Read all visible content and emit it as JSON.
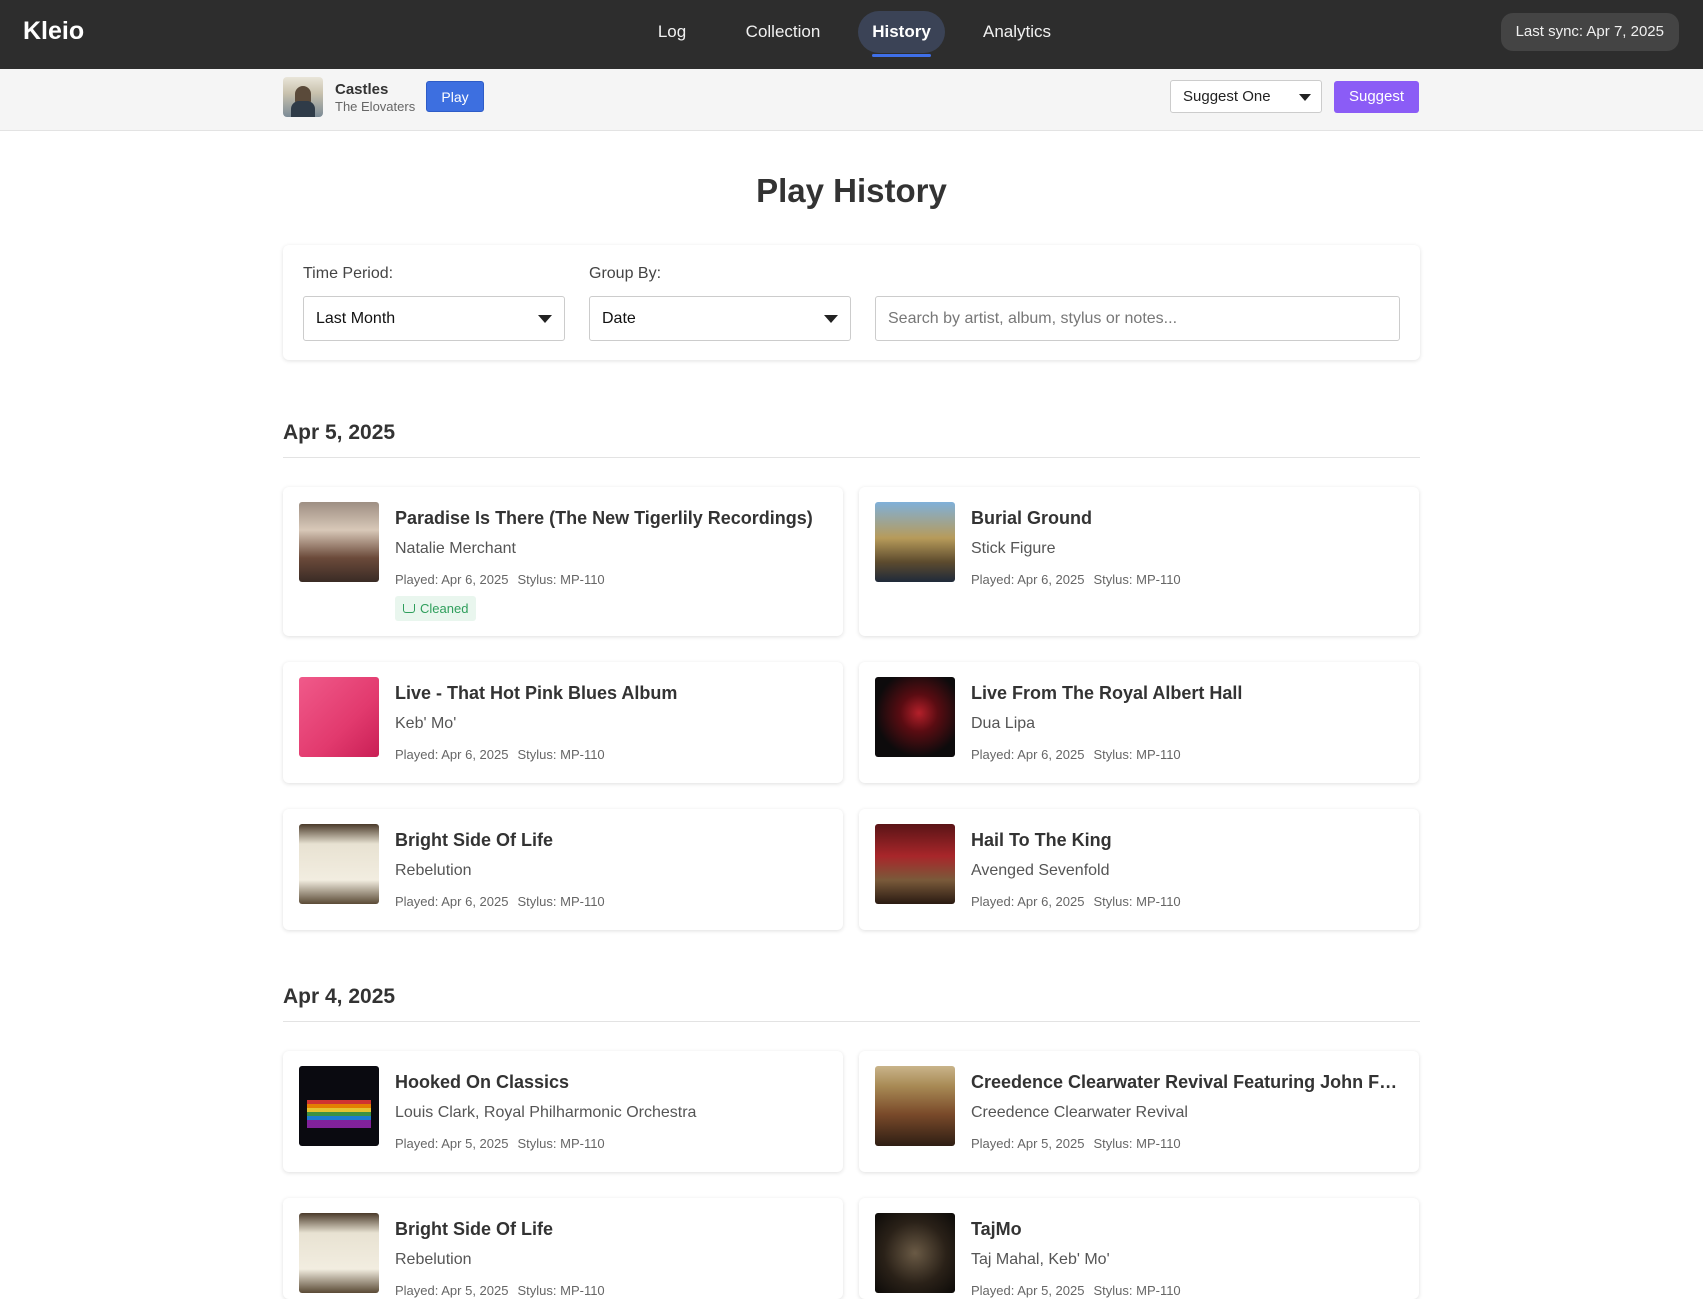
{
  "app": {
    "brand": "Kleio"
  },
  "nav": {
    "items": [
      {
        "label": "Log",
        "active": false
      },
      {
        "label": "Collection",
        "active": false
      },
      {
        "label": "History",
        "active": true
      },
      {
        "label": "Analytics",
        "active": false
      }
    ],
    "sync_status": "Last sync: Apr 7, 2025"
  },
  "now_playing": {
    "title": "Castles",
    "artist": "The Elovaters",
    "play_label": "Play",
    "suggest_select_value": "Suggest One",
    "suggest_label": "Suggest"
  },
  "page": {
    "title": "Play History",
    "filters": {
      "time_period_label": "Time Period:",
      "time_period_value": "Last Month",
      "group_by_label": "Group By:",
      "group_by_value": "Date",
      "search_placeholder": "Search by artist, album, stylus or notes...",
      "search_value": ""
    }
  },
  "groups": [
    {
      "date": "Apr 5, 2025",
      "plays": [
        {
          "title": "Paradise Is There (The New Tigerlily Recordings)",
          "artist": "Natalie Merchant",
          "played": "Played: Apr 6, 2025",
          "stylus": "Stylus: MP-110",
          "badge": "Cleaned"
        },
        {
          "title": "Burial Ground",
          "artist": "Stick Figure",
          "played": "Played: Apr 6, 2025",
          "stylus": "Stylus: MP-110"
        },
        {
          "title": "Live - That Hot Pink Blues Album",
          "artist": "Keb' Mo'",
          "played": "Played: Apr 6, 2025",
          "stylus": "Stylus: MP-110"
        },
        {
          "title": "Live From The Royal Albert Hall",
          "artist": "Dua Lipa",
          "played": "Played: Apr 6, 2025",
          "stylus": "Stylus: MP-110"
        },
        {
          "title": "Bright Side Of Life",
          "artist": "Rebelution",
          "played": "Played: Apr 6, 2025",
          "stylus": "Stylus: MP-110"
        },
        {
          "title": "Hail To The King",
          "artist": "Avenged Sevenfold",
          "played": "Played: Apr 6, 2025",
          "stylus": "Stylus: MP-110"
        }
      ]
    },
    {
      "date": "Apr 4, 2025",
      "plays": [
        {
          "title": "Hooked On Classics",
          "artist": "Louis Clark, Royal Philharmonic Orchestra",
          "played": "Played: Apr 5, 2025",
          "stylus": "Stylus: MP-110"
        },
        {
          "title": "Creedence Clearwater Revival Featuring John Fogerty",
          "artist": "Creedence Clearwater Revival",
          "played": "Played: Apr 5, 2025",
          "stylus": "Stylus: MP-110"
        },
        {
          "title": "Bright Side Of Life",
          "artist": "Rebelution",
          "played": "Played: Apr 5, 2025",
          "stylus": "Stylus: MP-110"
        },
        {
          "title": "TajMo",
          "artist": "Taj Mahal, Keb' Mo'",
          "played": "Played: Apr 5, 2025",
          "stylus": "Stylus: MP-110"
        }
      ]
    }
  ],
  "colors": {
    "nav_bg": "#2d2d2d",
    "play_button": "#3d6fe0",
    "suggest_button": "#8b5cf6",
    "cleaned_badge": "#2e9e5b"
  }
}
